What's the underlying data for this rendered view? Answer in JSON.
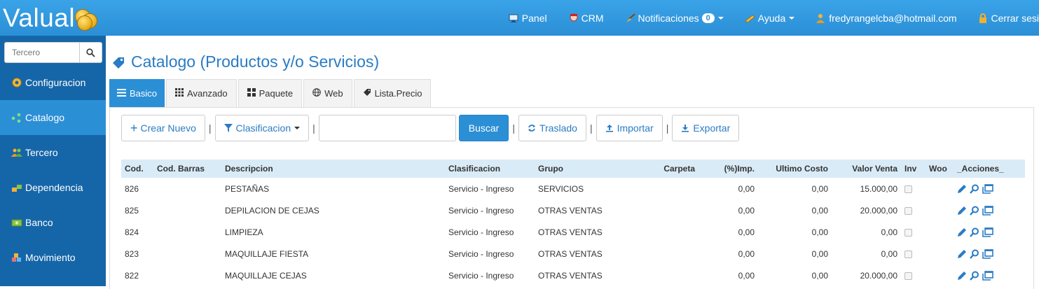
{
  "app": {
    "logo_text": "Valual"
  },
  "topnav": {
    "panel": "Panel",
    "crm": "CRM",
    "notifications": "Notificaciones",
    "notifications_count": "0",
    "help": "Ayuda",
    "user_email": "fredyrangelcba@hotmail.com",
    "logout": "Cerrar sesi"
  },
  "sidebar": {
    "search_placeholder": "Tercero",
    "items": [
      {
        "label": "Configuracion",
        "icon": "gear-icon"
      },
      {
        "label": "Catalogo",
        "icon": "share-nodes-icon",
        "active": true
      },
      {
        "label": "Tercero",
        "icon": "users-icon"
      },
      {
        "label": "Dependencia",
        "icon": "blocks-icon"
      },
      {
        "label": "Banco",
        "icon": "money-icon"
      },
      {
        "label": "Movimiento",
        "icon": "boxes-icon"
      }
    ]
  },
  "page": {
    "title": "Catalogo (Productos y/o Servicios)",
    "tabs": [
      {
        "label": "Basico",
        "active": true
      },
      {
        "label": "Avanzado"
      },
      {
        "label": "Paquete"
      },
      {
        "label": "Web"
      },
      {
        "label": "Lista.Precio"
      }
    ]
  },
  "toolbar": {
    "new_label": "Crear Nuevo",
    "classification_label": "Clasificacion",
    "search_value": "",
    "search_button": "Buscar",
    "transfer_label": "Traslado",
    "import_label": "Importar",
    "export_label": "Exportar",
    "separator": "|"
  },
  "table": {
    "headers": [
      "Cod.",
      "Cod. Barras",
      "Descripcion",
      "Clasificacion",
      "Grupo",
      "Carpeta",
      "(%)Imp.",
      "Ultimo Costo",
      "Valor Venta",
      "Inv",
      "Woo",
      "_Acciones_"
    ],
    "rows": [
      {
        "cod": "826",
        "barras": "",
        "desc": "PESTAÑAS",
        "clasif": "Servicio - Ingreso",
        "grupo": "SERVICIOS",
        "carpeta": "",
        "imp": "0,00",
        "costo": "0,00",
        "venta": "15.000,00"
      },
      {
        "cod": "825",
        "barras": "",
        "desc": "DEPILACION DE CEJAS",
        "clasif": "Servicio - Ingreso",
        "grupo": "OTRAS VENTAS",
        "carpeta": "",
        "imp": "0,00",
        "costo": "0,00",
        "venta": "20.000,00"
      },
      {
        "cod": "824",
        "barras": "",
        "desc": "LIMPIEZA",
        "clasif": "Servicio - Ingreso",
        "grupo": "OTRAS VENTAS",
        "carpeta": "",
        "imp": "0,00",
        "costo": "0,00",
        "venta": "0,00"
      },
      {
        "cod": "823",
        "barras": "",
        "desc": "MAQUILLAJE FIESTA",
        "clasif": "Servicio - Ingreso",
        "grupo": "OTRAS VENTAS",
        "carpeta": "",
        "imp": "0,00",
        "costo": "0,00",
        "venta": "0,00"
      },
      {
        "cod": "822",
        "barras": "",
        "desc": "MAQUILLAJE CEJAS",
        "clasif": "Servicio - Ingreso",
        "grupo": "OTRAS VENTAS",
        "carpeta": "",
        "imp": "0,00",
        "costo": "0,00",
        "venta": "20.000,00"
      }
    ]
  },
  "colors": {
    "primary": "#2b8fd6",
    "sidebar": "#1566a8",
    "title": "#2a7cc4",
    "table_header": "#d9ebf6"
  }
}
